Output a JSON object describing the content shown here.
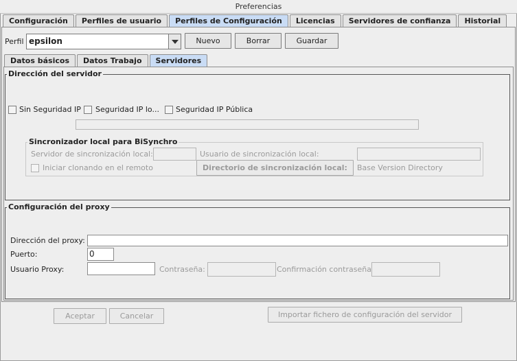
{
  "window": {
    "title": "Preferencias"
  },
  "top_tabs": [
    {
      "label": "Configuración",
      "active": false
    },
    {
      "label": "Perfiles de usuario",
      "active": false
    },
    {
      "label": "Perfiles de Configuración",
      "active": true
    },
    {
      "label": "Licencias",
      "active": false
    },
    {
      "label": "Servidores de confianza",
      "active": false
    },
    {
      "label": "Historial",
      "active": false
    }
  ],
  "profile": {
    "label": "Perfil",
    "selected": "epsilon",
    "new_label": "Nuevo",
    "delete_label": "Borrar",
    "save_label": "Guardar"
  },
  "sub_tabs": [
    {
      "label": "Datos básicos",
      "active": false
    },
    {
      "label": "Datos Trabajo",
      "active": false
    },
    {
      "label": "Servidores",
      "active": true
    }
  ],
  "server_address": {
    "title": "Dirección del servidor",
    "checkbox_no_security": "Sin Seguridad IP",
    "checkbox_local_security": "Seguridad IP lo...",
    "checkbox_public_security": "Seguridad IP Pública",
    "address_value": "",
    "bisynchro": {
      "title": "Sincronizador local para BiSynchro",
      "sync_server_label": "Servidor de sincronización local:",
      "sync_server_value": "",
      "sync_user_label": "Usuario de sincronización local:",
      "sync_user_value": "",
      "clone_label": "Iniciar clonando en el remoto",
      "sync_dir_button": "Directorio de sincronización local:",
      "sync_dir_value": "Base Version Directory"
    }
  },
  "proxy": {
    "title": "Configuración del proxy",
    "address_label": "Dirección del proxy:",
    "address_value": "",
    "port_label": "Puerto:",
    "port_value": "0",
    "user_label": "Usuario Proxy:",
    "user_value": "",
    "password_label": "Contraseña:",
    "password_value": "",
    "confirm_label": "Confirmación contraseña:",
    "confirm_value": ""
  },
  "footer": {
    "accept_label": "Aceptar",
    "cancel_label": "Cancelar",
    "import_label": "Importar fichero de configuración del servidor"
  },
  "colors": {
    "active_tab": "#c9dcf5",
    "background": "#eeeeee",
    "disabled_text": "#9a9a9a"
  }
}
